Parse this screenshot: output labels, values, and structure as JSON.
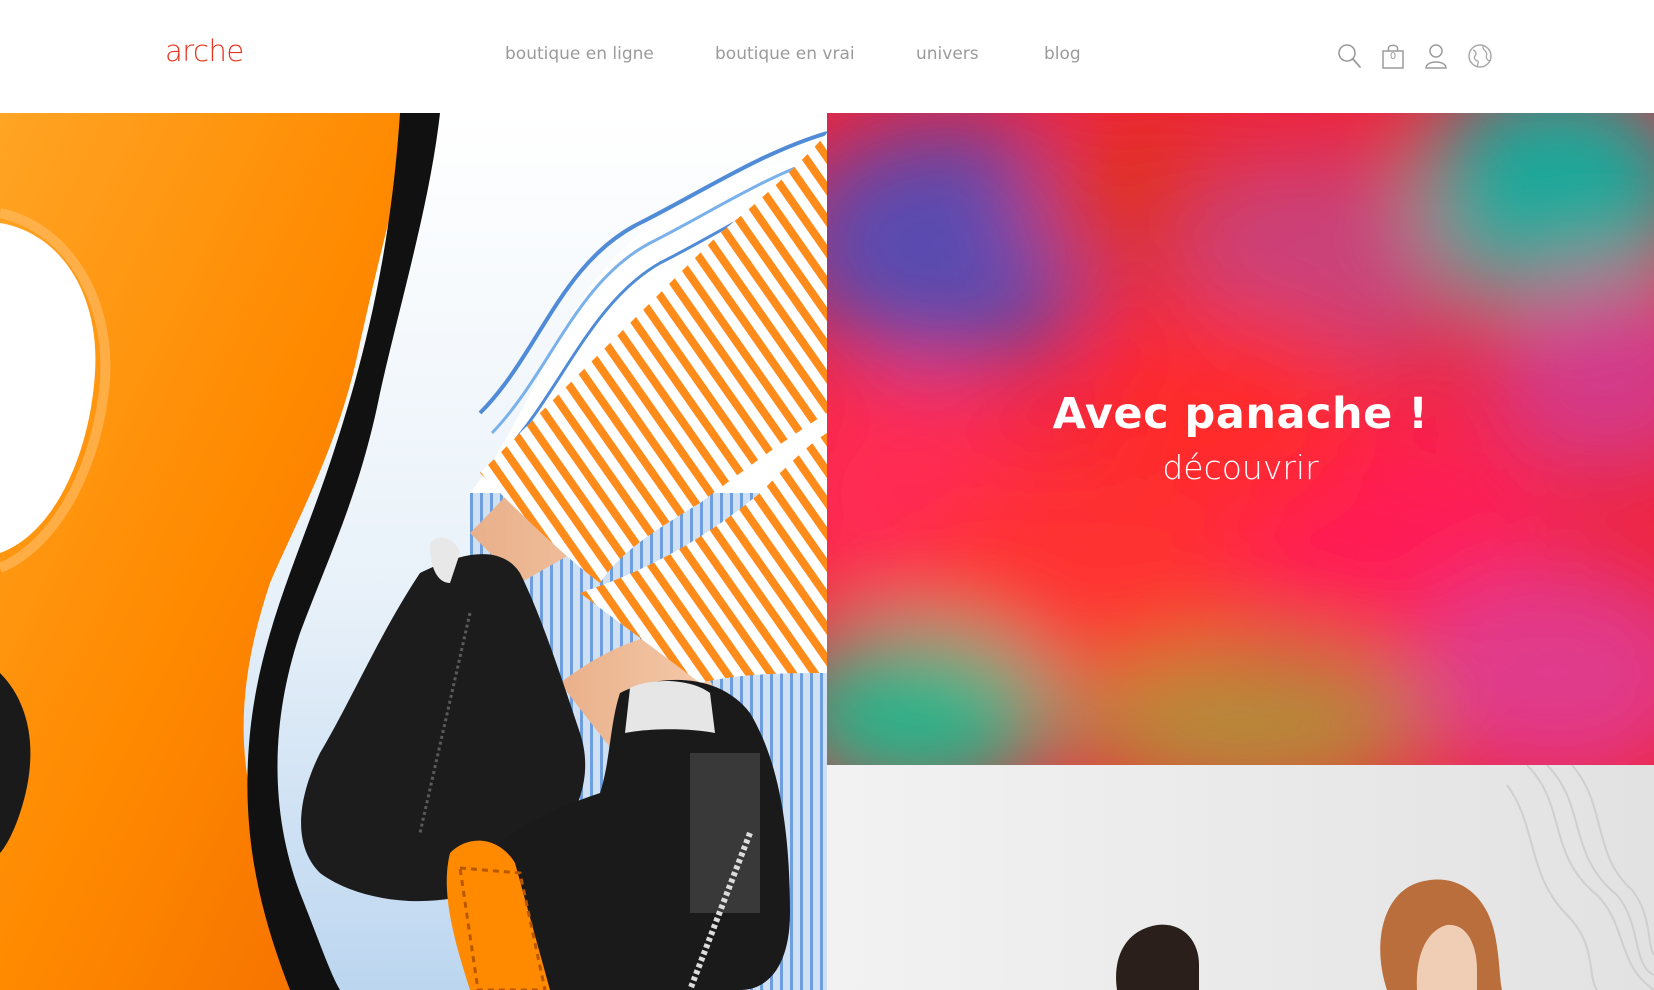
{
  "header": {
    "logo_text": "arche",
    "nav": [
      {
        "label": "boutique en ligne"
      },
      {
        "label": "boutique en vrai"
      },
      {
        "label": "univers"
      },
      {
        "label": "blog"
      }
    ],
    "icons": {
      "search": "search-icon",
      "bag": "shopping-bag-icon",
      "bag_count": "0",
      "account": "user-icon",
      "language": "globe-icon"
    }
  },
  "hero": {
    "promo_title": "Avec panache !",
    "promo_link": "découvrir"
  },
  "colors": {
    "brand": "#e5331c",
    "nav_text": "#9b9b9b",
    "orange": "#ff8a00"
  }
}
